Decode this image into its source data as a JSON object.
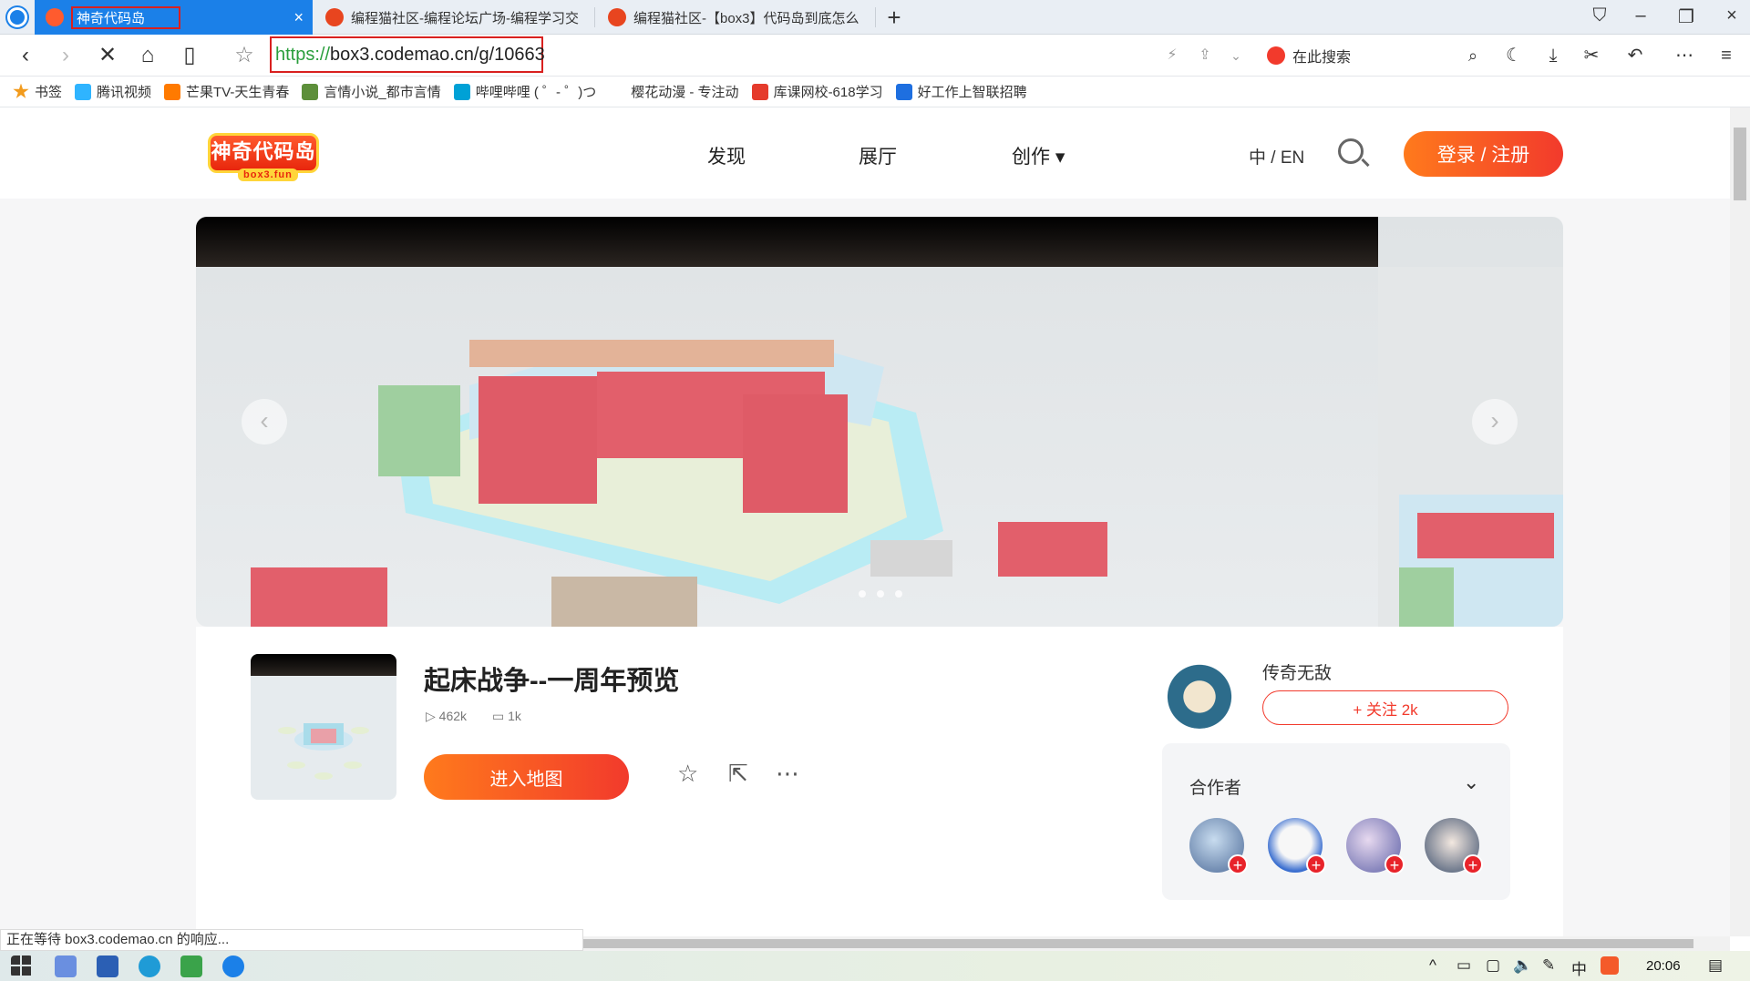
{
  "browser": {
    "tabs": [
      {
        "label": "神奇代码岛",
        "active": true
      },
      {
        "label": "编程猫社区-编程论坛广场-编程学习交",
        "active": false
      },
      {
        "label": "编程猫社区-【box3】代码岛到底怎么",
        "active": false
      }
    ],
    "new_tab": "+",
    "url_scheme": "https://",
    "url_host": "box3.codemao.cn/g/10663",
    "search_placeholder": "在此搜索"
  },
  "bookmarks": [
    {
      "label": "书签",
      "color": "#f29b1d"
    },
    {
      "label": "腾讯视频",
      "color": "#2fb4ff"
    },
    {
      "label": "芒果TV-天生青春",
      "color": "#ff7a00"
    },
    {
      "label": "言情小说_都市言情",
      "color": "#5d8f3a"
    },
    {
      "label": "哔哩哔哩 ( ゜- ゜)つ",
      "color": "#00a1d6"
    },
    {
      "label": "樱花动漫 - 专注动",
      "color": "#ffffff"
    },
    {
      "label": "库课网校-618学习",
      "color": "#e53b2c"
    },
    {
      "label": "好工作上智联招聘",
      "color": "#1e6fe0"
    }
  ],
  "site": {
    "logo_text": "神奇代码岛",
    "logo_sub": "box3.fun",
    "nav": [
      "发现",
      "展厅",
      "创作 ▾"
    ],
    "lang": "中 / EN",
    "login": "登录 / 注册"
  },
  "game": {
    "title": "起床战争--一周年预览",
    "views": "462k",
    "comments": "1k",
    "enter": "进入地图"
  },
  "author": {
    "name": "传奇无敌",
    "follow": "+ 关注 2k"
  },
  "collaborators": {
    "label": "合作者",
    "count": 4
  },
  "status_text": "正在等待 box3.codemao.cn 的响应...",
  "clock": "20:06"
}
